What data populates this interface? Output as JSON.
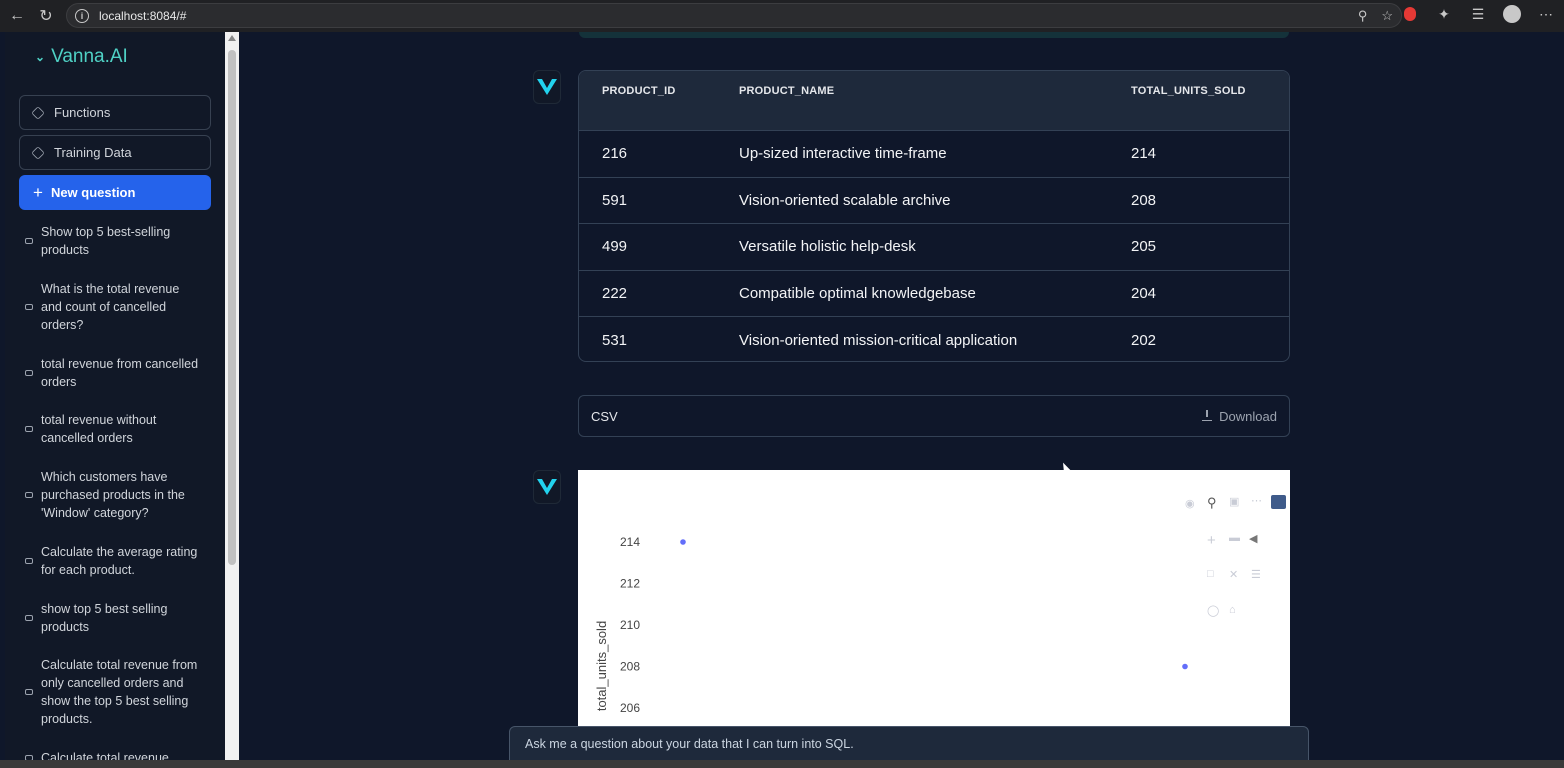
{
  "browser": {
    "url": "localhost:8084/#",
    "back_icon": "arrow-left-icon",
    "reload_icon": "reload-icon"
  },
  "sidebar": {
    "brand": "Vanna.AI",
    "functions_label": "Functions",
    "training_label": "Training Data",
    "new_question_label": "New question",
    "history": [
      "Show top 5 best-selling products",
      "What is the total revenue and count of cancelled orders?",
      "total revenue from cancelled orders",
      "total revenue without cancelled orders",
      "Which customers have purchased products in the 'Window' category?",
      "Calculate the average rating for each product.",
      "show top 5 best selling products",
      "Calculate total revenue from only cancelled orders and show the top 5 best selling products.",
      "Calculate total revenue"
    ]
  },
  "table": {
    "headers": [
      "PRODUCT_ID",
      "PRODUCT_NAME",
      "TOTAL_UNITS_SOLD"
    ],
    "rows": [
      [
        "216",
        "Up-sized interactive time-frame",
        "214"
      ],
      [
        "591",
        "Vision-oriented scalable archive",
        "208"
      ],
      [
        "499",
        "Versatile holistic help-desk",
        "205"
      ],
      [
        "222",
        "Compatible optimal knowledgebase",
        "204"
      ],
      [
        "531",
        "Vision-oriented mission-critical application",
        "202"
      ]
    ]
  },
  "csv": {
    "label": "CSV",
    "download_label": "Download"
  },
  "chart_data": {
    "type": "scatter",
    "ylabel": "total_units_sold",
    "y_ticks": [
      "214",
      "212",
      "210",
      "208",
      "206"
    ],
    "ylim": [
      205,
      215
    ],
    "points": [
      {
        "y": 214
      },
      {
        "y": 208
      }
    ],
    "marker_color": "#636efa"
  },
  "ask": {
    "placeholder": "Ask me a question about your data that I can turn into SQL."
  }
}
